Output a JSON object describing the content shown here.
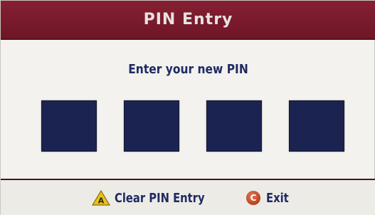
{
  "dialog": {
    "title": "PIN Entry",
    "prompt": "Enter your new PIN",
    "pin_slots": [
      {
        "value": ""
      },
      {
        "value": ""
      },
      {
        "value": ""
      },
      {
        "value": ""
      }
    ]
  },
  "footer": {
    "clear": {
      "icon_letter": "A",
      "label": "Clear PIN Entry"
    },
    "exit": {
      "icon_letter": "C",
      "label": "Exit"
    }
  },
  "colors": {
    "title_bar": "#7a1a2b",
    "title_text": "#e8e3df",
    "body_bg": "#f3f2ee",
    "prompt_text": "#1f2a63",
    "pin_box": "#1b2450",
    "button_a": "#e8c21a",
    "button_c": "#b8421f"
  }
}
